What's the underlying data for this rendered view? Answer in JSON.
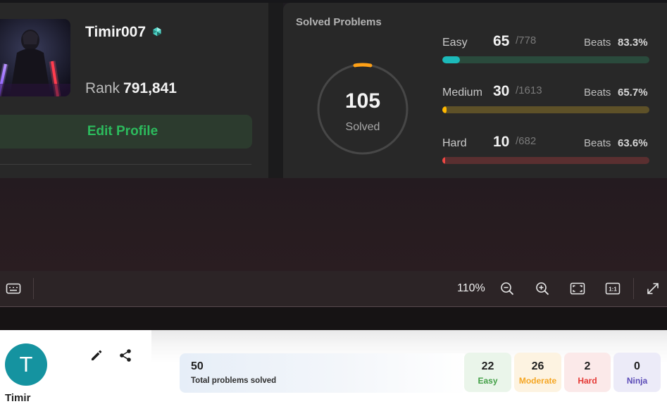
{
  "profile": {
    "username": "Timir007",
    "rank_label": "Rank",
    "rank_value": "791,841",
    "edit_button": "Edit Profile"
  },
  "solved": {
    "title": "Solved Problems",
    "total": "105",
    "total_label": "Solved",
    "difficulties": [
      {
        "name": "Easy",
        "solved": "65",
        "total": "/778",
        "beats_label": "Beats",
        "beats": "83.3%",
        "progress": 0.084,
        "color": "#1cbaba",
        "track": "#2a4a3c"
      },
      {
        "name": "Medium",
        "solved": "30",
        "total": "/1613",
        "beats_label": "Beats",
        "beats": "65.7%",
        "progress": 0.019,
        "color": "#ffb800",
        "track": "#5e5128"
      },
      {
        "name": "Hard",
        "solved": "10",
        "total": "/682",
        "beats_label": "Beats",
        "beats": "63.6%",
        "progress": 0.015,
        "color": "#ef4743",
        "track": "#5a2f30"
      }
    ]
  },
  "toolbar": {
    "zoom": "110%",
    "icons": [
      "keyboard-icon",
      "zoom-out-icon",
      "zoom-in-icon",
      "fit-screen-icon",
      "actual-size-icon",
      "expand-icon"
    ]
  },
  "bottom_profile": {
    "avatar_letter": "T",
    "name": "Timir",
    "total_count": "50",
    "total_label": "Total problems solved",
    "stats": [
      {
        "count": "22",
        "label": "Easy",
        "label_color": "#43a047",
        "bg": "#eaf5ea"
      },
      {
        "count": "26",
        "label": "Moderate",
        "label_color": "#f5a623",
        "bg": "#fdf3e1"
      },
      {
        "count": "2",
        "label": "Hard",
        "label_color": "#e53935",
        "bg": "#fbe9e9"
      },
      {
        "count": "0",
        "label": "Ninja",
        "label_color": "#5b4bb7",
        "bg": "#ecebf8"
      }
    ]
  },
  "colors": {
    "accent_green": "#2cbb5d",
    "ring_arc": "#ffa116",
    "avatar_teal": "#1593a0"
  }
}
